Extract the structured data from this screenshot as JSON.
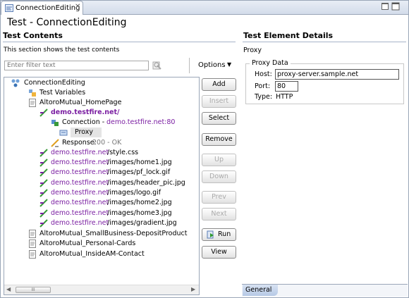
{
  "tab": {
    "label": "ConnectionEditing",
    "close": "✕"
  },
  "page_title": "Test - ConnectionEditing",
  "left": {
    "heading": "Test Contents",
    "description": "This section shows the test contents",
    "filter_placeholder": "Enter filter text",
    "options_label": "Options",
    "options_chevron": "▼"
  },
  "tree": {
    "root": "ConnectionEditing",
    "test_variables": "Test Variables",
    "page1": "AltoroMutual_HomePage",
    "host": "demo.testfire.net/",
    "connection_prefix": "Connection - ",
    "connection_host": "demo.testfire.net:80",
    "proxy": "Proxy",
    "response_prefix": "Response: ",
    "response_status": "200 - OK",
    "req_host": "demo.testfire.net",
    "requests": [
      "/style.css",
      "/images/home1.jpg",
      "/images/pf_lock.gif",
      "/images/header_pic.jpg",
      "/images/logo.gif",
      "/images/home2.jpg",
      "/images/home3.jpg",
      "/images/gradient.jpg"
    ],
    "page2": "AltoroMutual_SmallBusiness-DepositProduct",
    "page3": "AltoroMutual_Personal-Cards",
    "page4": "AltoroMutual_InsideAM-Contact",
    "scroll_grip": "III"
  },
  "buttons": {
    "add": "Add",
    "insert": "Insert",
    "select": "Select",
    "remove": "Remove",
    "up": "Up",
    "down": "Down",
    "prev": "Prev",
    "next": "Next",
    "run": "Run",
    "view": "View"
  },
  "right": {
    "heading": "Test Element Details",
    "subheading": "Proxy",
    "group_label": "Proxy Data",
    "host_label": "Host:",
    "host_value": "proxy-server.sample.net",
    "port_label": "Port:",
    "port_value": "80",
    "type_label": "Type:",
    "type_value": "HTTP"
  },
  "bottom_tab": "General",
  "colors": {
    "link_purple": "#7b1fa2",
    "accent_blue": "#9aa6b8"
  }
}
